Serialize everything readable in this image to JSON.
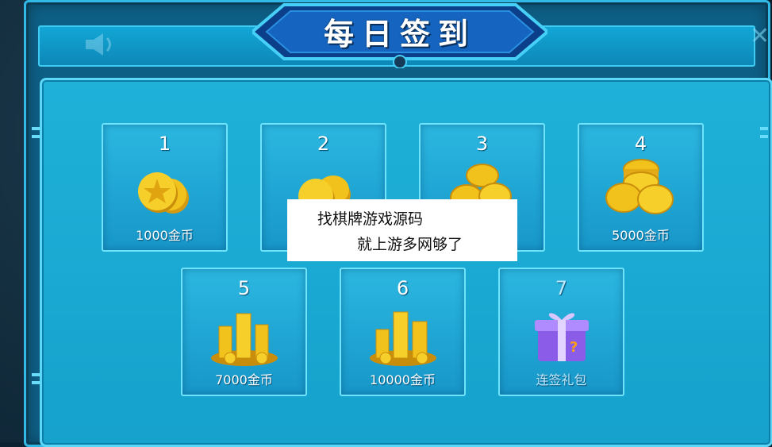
{
  "title": "每日签到",
  "days": [
    {
      "day": "1",
      "reward": "1000金币",
      "icon": "coin-small-icon"
    },
    {
      "day": "2",
      "reward": "",
      "icon": "coin-small-icon"
    },
    {
      "day": "3",
      "reward": "",
      "icon": "coin-stack-icon"
    },
    {
      "day": "4",
      "reward": "5000金币",
      "icon": "coin-stack-icon"
    },
    {
      "day": "5",
      "reward": "7000金币",
      "icon": "coin-pile-icon"
    },
    {
      "day": "6",
      "reward": "10000金币",
      "icon": "coin-pile-icon"
    },
    {
      "day": "7",
      "reward": "连签礼包",
      "icon": "gift-box-icon"
    }
  ],
  "overlay": {
    "line1": "找棋牌游戏源码",
    "line2": "就上游多网够了"
  },
  "colors": {
    "panel": "#1fb1d8",
    "border": "#5bd7f7",
    "coin": "#f2c21c",
    "gift": "#9a6bff"
  }
}
